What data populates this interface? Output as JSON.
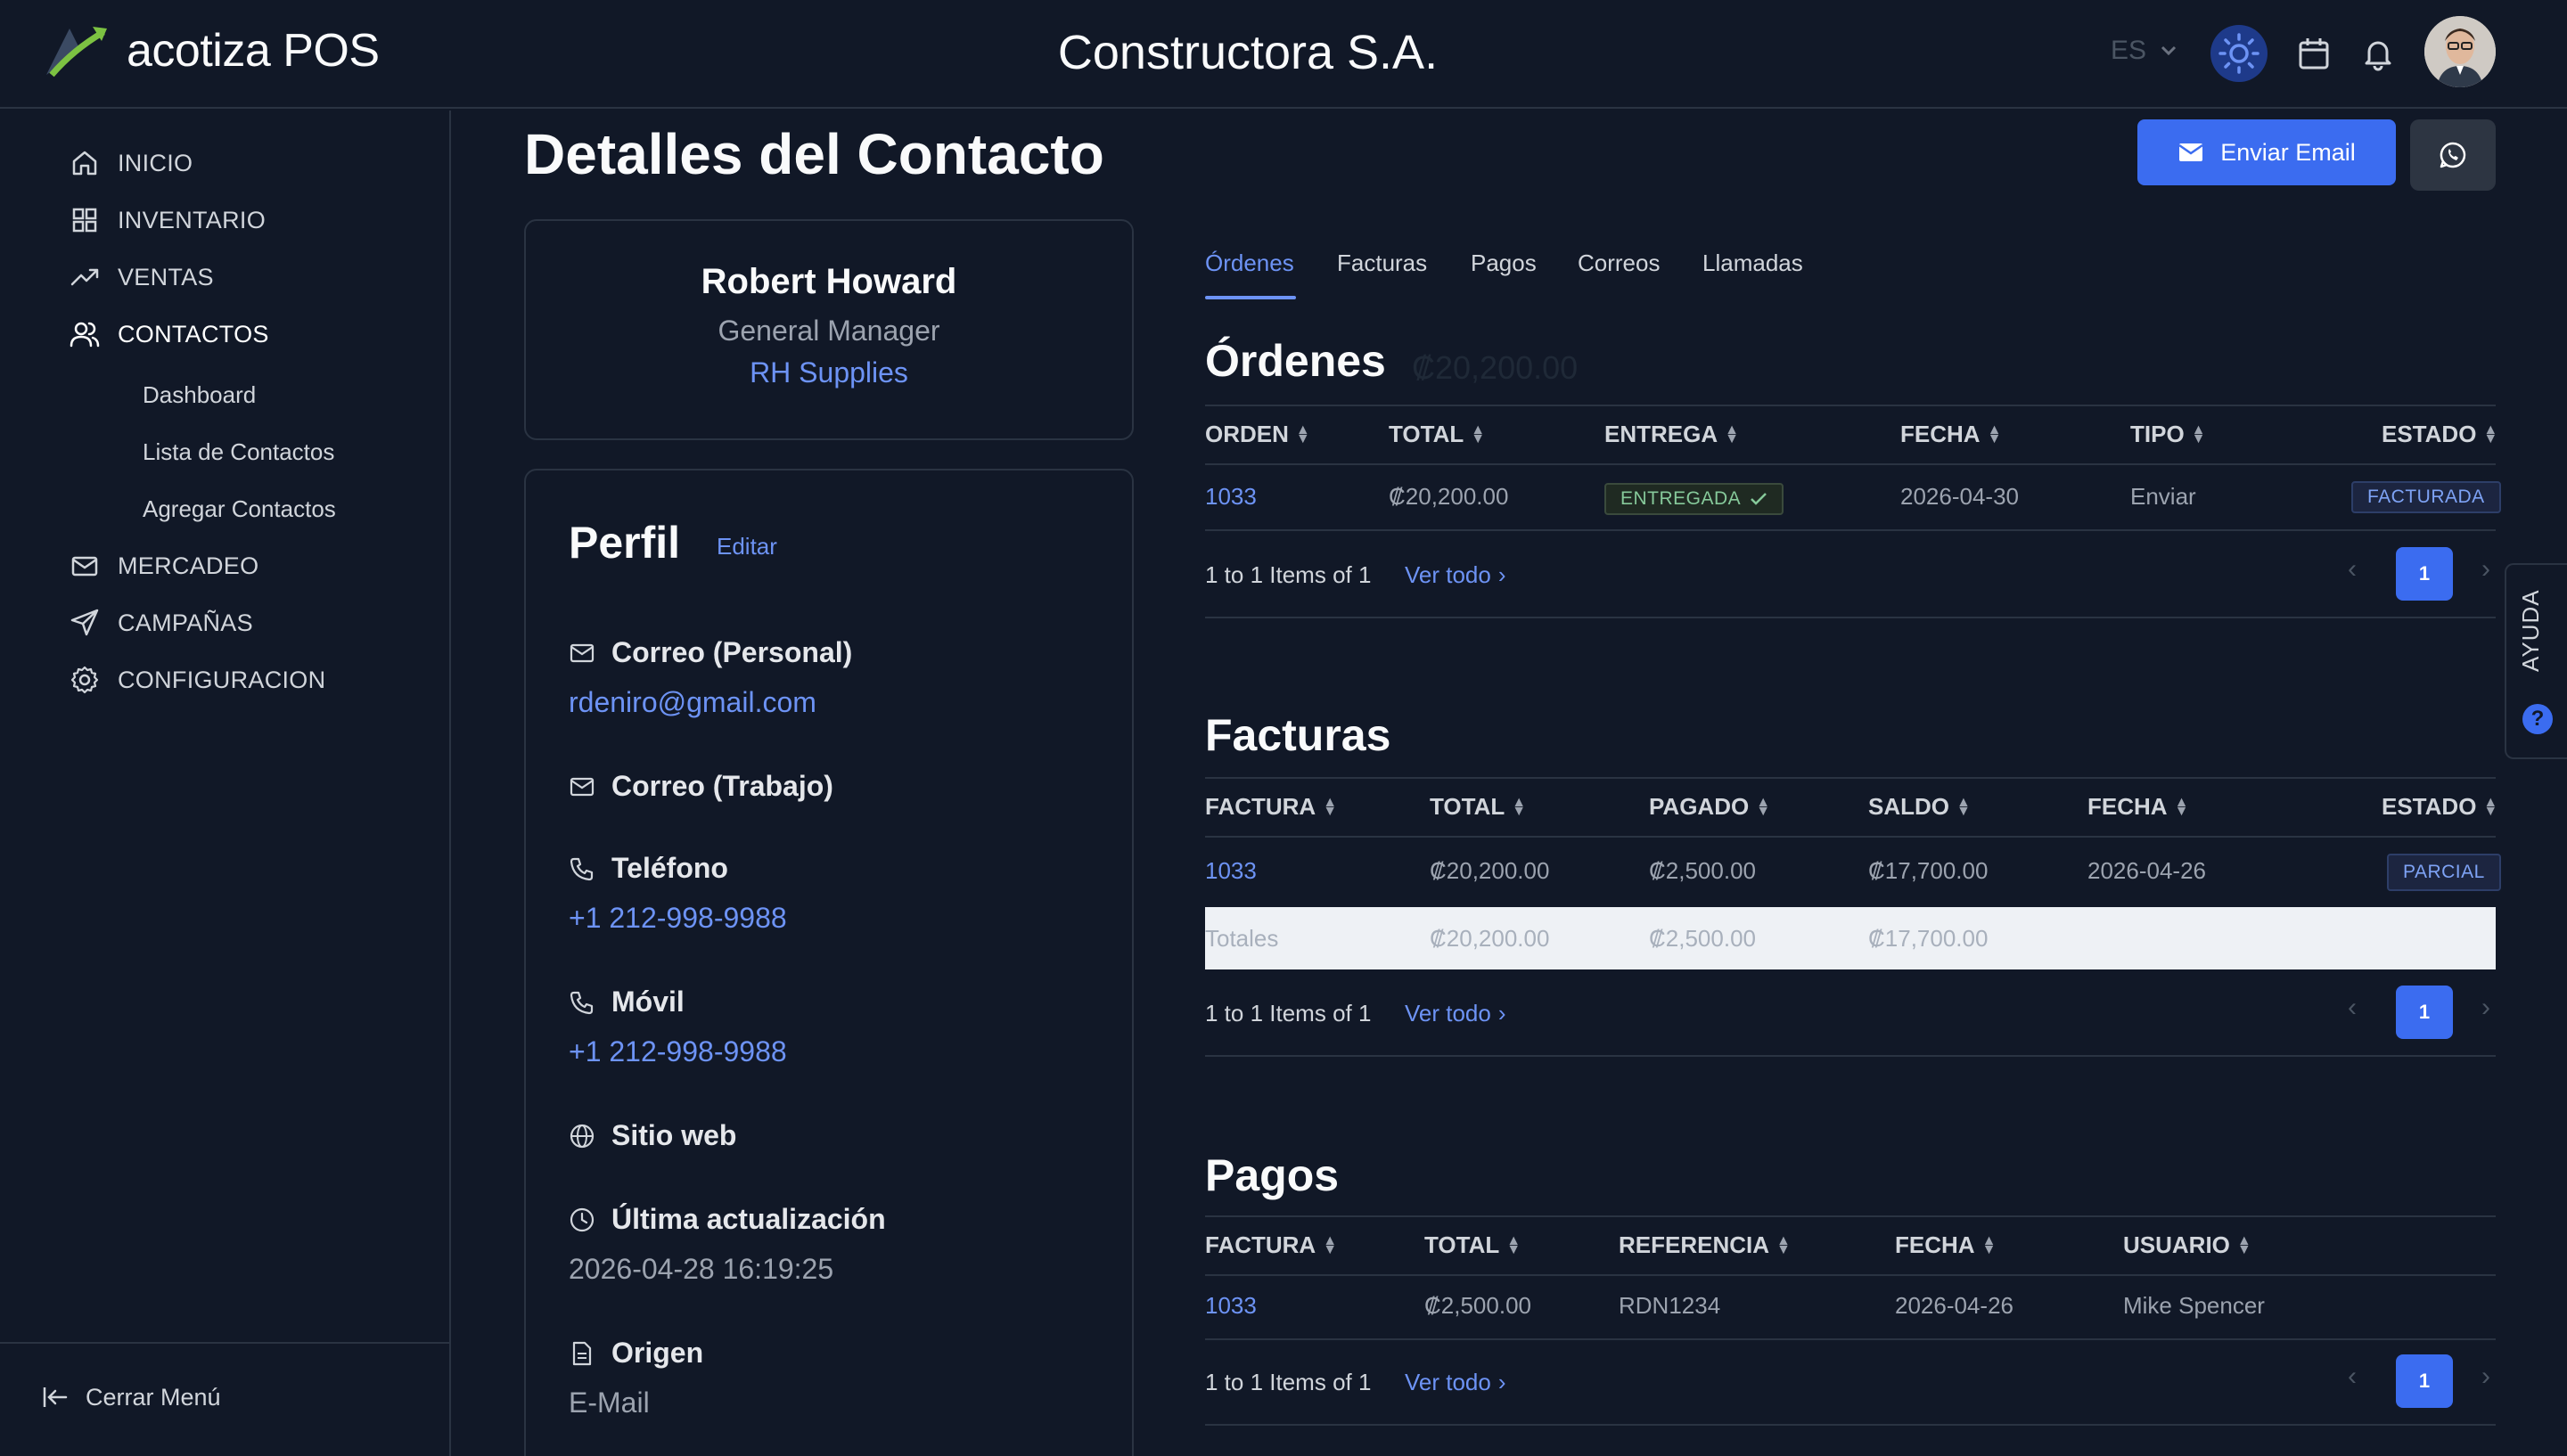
{
  "app": {
    "name": "acotiza POS",
    "company": "Constructora S.A.",
    "language": "ES"
  },
  "sidebar": {
    "items": [
      {
        "label": "INICIO",
        "icon": "home-icon"
      },
      {
        "label": "INVENTARIO",
        "icon": "grid-icon"
      },
      {
        "label": "VENTAS",
        "icon": "trending-up-icon"
      },
      {
        "label": "CONTACTOS",
        "icon": "users-icon"
      },
      {
        "label": "MERCADEO",
        "icon": "mail-icon"
      },
      {
        "label": "CAMPAÑAS",
        "icon": "send-icon"
      },
      {
        "label": "CONFIGURACION",
        "icon": "gear-icon"
      }
    ],
    "subitems": [
      "Dashboard",
      "Lista de Contactos",
      "Agregar Contactos"
    ],
    "collapse_label": "Cerrar Menú"
  },
  "page": {
    "title": "Detalles del Contacto",
    "email_button": "Enviar Email"
  },
  "contact": {
    "name": "Robert Howard",
    "role": "General Manager",
    "company": "RH Supplies"
  },
  "profile": {
    "title": "Perfil",
    "edit": "Editar",
    "fields": {
      "email_personal_label": "Correo (Personal)",
      "email_personal_value": "rdeniro@gmail.com",
      "email_work_label": "Correo (Trabajo)",
      "phone_label": "Teléfono",
      "phone_value": "+1 212-998-9988",
      "mobile_label": "Móvil",
      "mobile_value": "+1 212-998-9988",
      "website_label": "Sitio web",
      "updated_label": "Última actualización",
      "updated_value": "2026-04-28 16:19:25",
      "origin_label": "Origen",
      "origin_value": "E-Mail"
    }
  },
  "tabs": [
    "Órdenes",
    "Facturas",
    "Pagos",
    "Correos",
    "Llamadas"
  ],
  "orders": {
    "title": "Órdenes",
    "total": "₡20,200.00",
    "headers": [
      "ORDEN",
      "TOTAL",
      "ENTREGA",
      "FECHA",
      "TIPO",
      "ESTADO"
    ],
    "row": {
      "orden": "1033",
      "total": "₡20,200.00",
      "entrega": "ENTREGADA",
      "fecha": "2026-04-30",
      "tipo": "Enviar",
      "estado": "FACTURADA"
    }
  },
  "invoices": {
    "title": "Facturas",
    "headers": [
      "FACTURA",
      "TOTAL",
      "PAGADO",
      "SALDO",
      "FECHA",
      "ESTADO"
    ],
    "row": {
      "factura": "1033",
      "total": "₡20,200.00",
      "pagado": "₡2,500.00",
      "saldo": "₡17,700.00",
      "fecha": "2026-04-26",
      "estado": "PARCIAL"
    },
    "totals": {
      "label": "Totales",
      "total": "₡20,200.00",
      "pagado": "₡2,500.00",
      "saldo": "₡17,700.00"
    }
  },
  "payments": {
    "title": "Pagos",
    "headers": [
      "FACTURA",
      "TOTAL",
      "REFERENCIA",
      "FECHA",
      "USUARIO"
    ],
    "row": {
      "factura": "1033",
      "total": "₡2,500.00",
      "referencia": "RDN1234",
      "fecha": "2026-04-26",
      "usuario": "Mike Spencer"
    }
  },
  "pager": {
    "text": "1 to 1 Items of 1",
    "view_all": "Ver todo",
    "page": "1"
  },
  "help": {
    "label": "AYUDA",
    "icon_char": "?"
  },
  "colors": {
    "accent": "#3b6cf0",
    "link": "#6d93f5",
    "background": "#111827"
  }
}
